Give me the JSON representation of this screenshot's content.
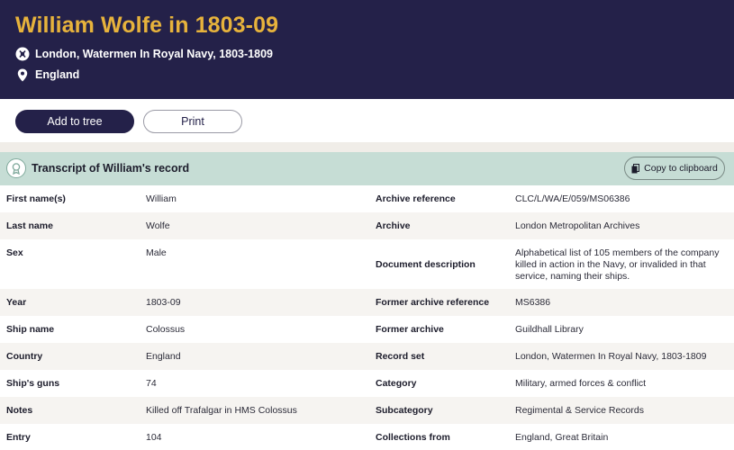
{
  "header": {
    "title": "William Wolfe in 1803-09",
    "collection": "London, Watermen In Royal Navy, 1803-1809",
    "location": "England",
    "icons": {
      "collection": "record-set-icon",
      "location": "map-pin-icon"
    },
    "colors": {
      "background": "#242149",
      "title": "#e7b33c"
    }
  },
  "actions": {
    "add_to_tree": "Add to tree",
    "print": "Print"
  },
  "transcript": {
    "title": "Transcript of William's record",
    "copy_label": "Copy to clipboard",
    "icon": "transcript-badge-icon",
    "rows": [
      {
        "l1": "First name(s)",
        "v1": "William",
        "l2": "Archive reference",
        "v2": "CLC/L/WA/E/059/MS06386"
      },
      {
        "l1": "Last name",
        "v1": "Wolfe",
        "l2": "Archive",
        "v2": "London Metropolitan Archives"
      },
      {
        "l1": "Sex",
        "v1": "Male",
        "l2": "Document description",
        "v2": "Alphabetical list of 105 members of the company killed in action in the Navy, or invalided in that service, naming their ships."
      },
      {
        "l1": "Year",
        "v1": "1803-09",
        "l2": "Former archive reference",
        "v2": "MS6386"
      },
      {
        "l1": "Ship name",
        "v1": "Colossus",
        "l2": "Former archive",
        "v2": "Guildhall Library"
      },
      {
        "l1": "Country",
        "v1": "England",
        "l2": "Record set",
        "v2": "London, Watermen In Royal Navy, 1803-1809"
      },
      {
        "l1": "Ship's guns",
        "v1": "74",
        "l2": "Category",
        "v2": "Military, armed forces & conflict"
      },
      {
        "l1": "Notes",
        "v1": "Killed off Trafalgar in HMS Colossus",
        "l2": "Subcategory",
        "v2": "Regimental & Service Records"
      },
      {
        "l1": "Entry",
        "v1": "104",
        "l2": "Collections from",
        "v2": "England, Great Britain"
      }
    ]
  }
}
